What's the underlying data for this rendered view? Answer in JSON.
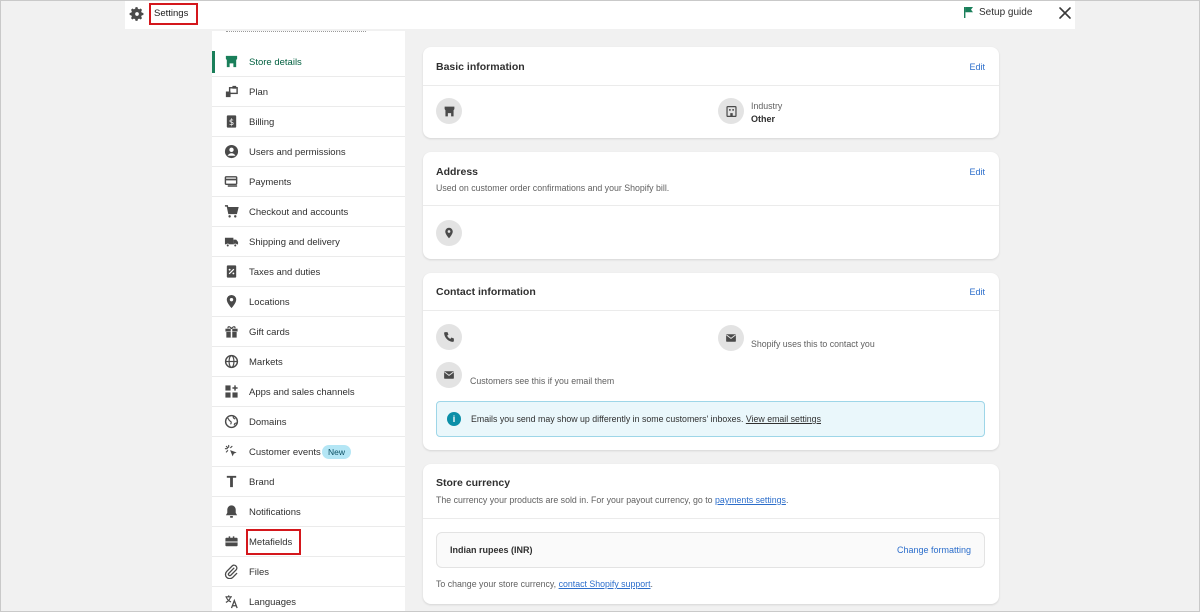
{
  "header": {
    "title": "Settings",
    "setup_guide": "Setup guide"
  },
  "sidebar": {
    "items": [
      {
        "label": "Store details",
        "icon": "store-icon"
      },
      {
        "label": "Plan",
        "icon": "plan-icon"
      },
      {
        "label": "Billing",
        "icon": "billing-icon"
      },
      {
        "label": "Users and permissions",
        "icon": "user-icon"
      },
      {
        "label": "Payments",
        "icon": "payments-icon"
      },
      {
        "label": "Checkout and accounts",
        "icon": "cart-icon"
      },
      {
        "label": "Shipping and delivery",
        "icon": "truck-icon"
      },
      {
        "label": "Taxes and duties",
        "icon": "tax-icon"
      },
      {
        "label": "Locations",
        "icon": "location-pin-icon"
      },
      {
        "label": "Gift cards",
        "icon": "gift-icon"
      },
      {
        "label": "Markets",
        "icon": "globe-icon"
      },
      {
        "label": "Apps and sales channels",
        "icon": "apps-icon"
      },
      {
        "label": "Domains",
        "icon": "domain-globe-icon"
      },
      {
        "label": "Customer events",
        "icon": "cursor-click-icon",
        "badge": "New"
      },
      {
        "label": "Brand",
        "icon": "brand-icon"
      },
      {
        "label": "Notifications",
        "icon": "bell-icon"
      },
      {
        "label": "Metafields",
        "icon": "metafields-icon"
      },
      {
        "label": "Files",
        "icon": "paperclip-icon"
      },
      {
        "label": "Languages",
        "icon": "translate-icon"
      }
    ]
  },
  "basic_info": {
    "title": "Basic information",
    "edit": "Edit",
    "industry_label": "Industry",
    "industry_value": "Other"
  },
  "address": {
    "title": "Address",
    "subtitle": "Used on customer order confirmations and your Shopify bill.",
    "edit": "Edit"
  },
  "contact": {
    "title": "Contact information",
    "edit": "Edit",
    "shopify_email_note": "Shopify uses this to contact you",
    "customer_email_note": "Customers see this if you email them",
    "banner_text": "Emails you send may show up differently in some customers' inboxes.",
    "banner_link": "View email settings"
  },
  "currency": {
    "title": "Store currency",
    "subtitle_prefix": "The currency your products are sold in. For your payout currency, go to",
    "subtitle_link": "payments settings",
    "subtitle_suffix": ".",
    "value": "Indian rupees (INR)",
    "change": "Change formatting",
    "footer_prefix": "To change your store currency,",
    "footer_link": "contact Shopify support",
    "footer_suffix": "."
  },
  "colors": {
    "accent": "#1a7f5a",
    "link": "#2c6ecb",
    "highlight": "#d4171c"
  }
}
